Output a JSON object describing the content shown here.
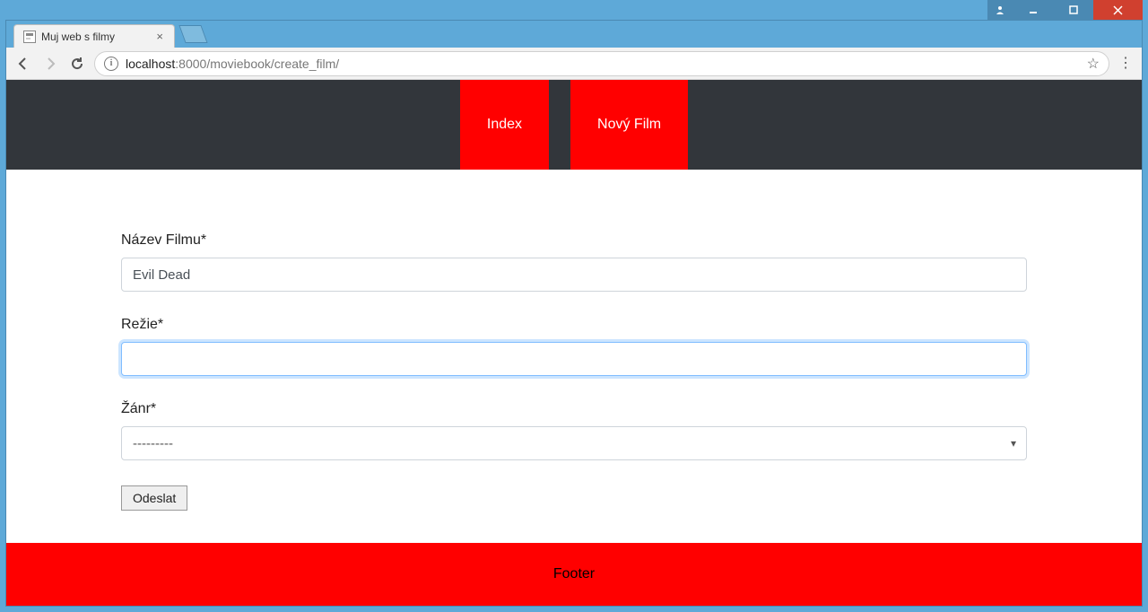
{
  "browser": {
    "tab_title": "Muj web s filmy",
    "url_host": "localhost",
    "url_port": ":8000",
    "url_path": "/moviebook/create_film/"
  },
  "nav": {
    "items": [
      {
        "label": "Index"
      },
      {
        "label": "Nový Film"
      }
    ]
  },
  "form": {
    "title_label": "Název Filmu*",
    "title_value": "Evil Dead",
    "director_label": "Režie*",
    "director_value": "",
    "genre_label": "Žánr*",
    "genre_selected": "---------",
    "submit_label": "Odeslat"
  },
  "footer": {
    "text": "Footer"
  }
}
